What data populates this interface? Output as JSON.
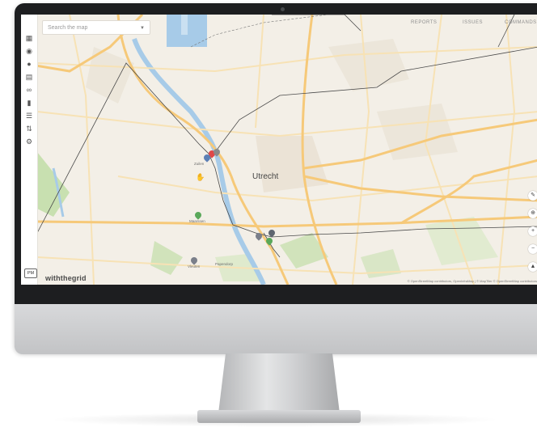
{
  "search": {
    "placeholder": "Search the map"
  },
  "topnav": [
    "REPORTS",
    "ISSUES",
    "COMMANDS"
  ],
  "map": {
    "city": "Utrecht",
    "stations": [
      "Zuilen",
      "Maarssen",
      "Vleuten",
      "Papendorp"
    ],
    "logo": "withthegrid",
    "mode_badge": "PM",
    "attribution": "© OpenStreetMap contributors, OpenInfraMap | © MapTiler © OpenStreetMap contributors"
  },
  "toolbar_icons": [
    "map-icon",
    "globe-icon",
    "pin-icon",
    "grid-icon",
    "connection-icon",
    "chart-icon",
    "layers-icon",
    "sort-icon",
    "gear-icon"
  ],
  "zoom_controls": [
    "edit",
    "locate",
    "zoom-in",
    "zoom-out",
    "compass"
  ],
  "colors": {
    "road_major": "#f6c979",
    "road_minor": "#f7e2b5",
    "water": "#a7cbe8",
    "green": "#c8e0b0",
    "line": "#4a4a4a"
  }
}
